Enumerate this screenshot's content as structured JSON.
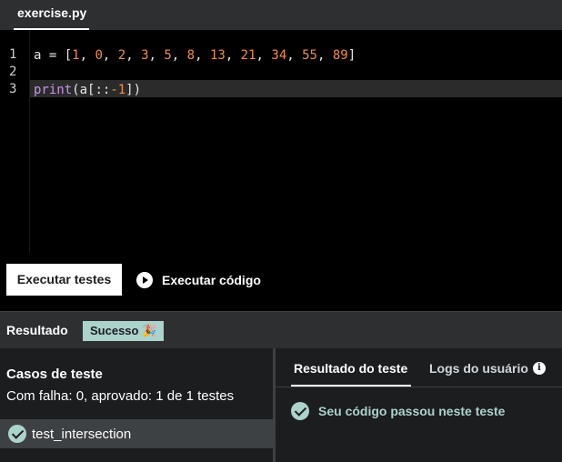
{
  "tabs": {
    "active_file": "exercise.py"
  },
  "editor": {
    "line_numbers": [
      "1",
      "2",
      "3"
    ],
    "line1": {
      "var": "a",
      "op": " = ",
      "open": "[",
      "numbers": [
        "1",
        "0",
        "2",
        "3",
        "5",
        "8",
        "13",
        "21",
        "34",
        "55",
        "89"
      ],
      "sep": ", ",
      "close": "]"
    },
    "line3": {
      "fn": "print",
      "open": "(",
      "arg": "a[::",
      "neg": "-1",
      "close": "])"
    }
  },
  "actions": {
    "run_tests_label": "Executar testes",
    "run_code_label": "Executar código"
  },
  "result": {
    "label": "Resultado",
    "status_badge": "Sucesso 🎉"
  },
  "test_cases": {
    "title": "Casos de teste",
    "summary": "Com falha: 0, aprovado: 1 de 1 testes",
    "items": [
      {
        "name": "test_intersection",
        "status": "passed"
      }
    ]
  },
  "details": {
    "tab_result": "Resultado do teste",
    "tab_logs": "Logs do usuário",
    "message": "Seu código passou neste teste"
  },
  "colors": {
    "accent_success": "#acd2cc",
    "number": "#f08d49",
    "function": "#c792ea"
  }
}
